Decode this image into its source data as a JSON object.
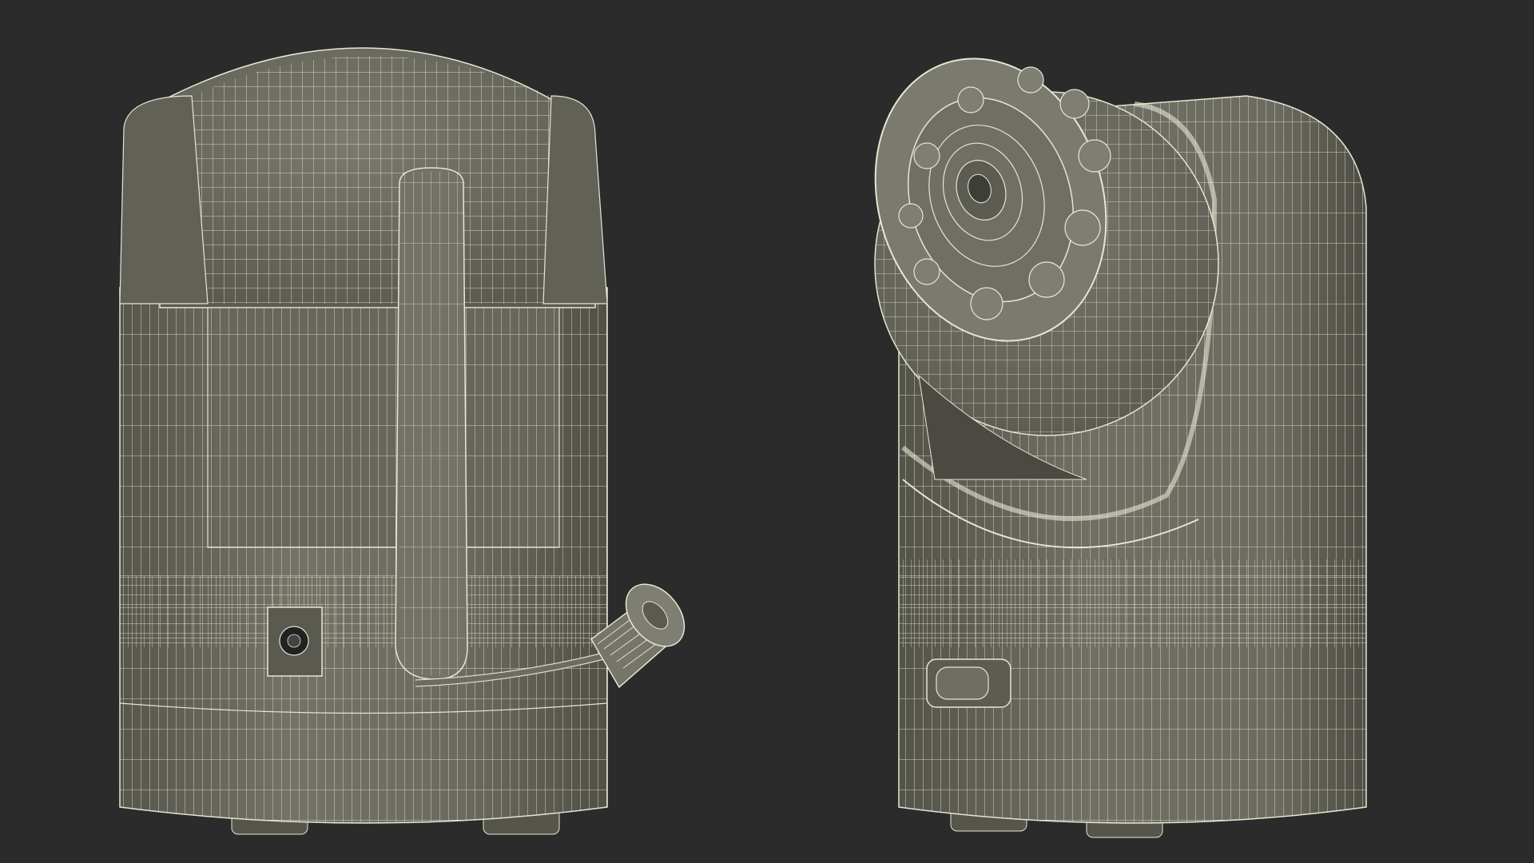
{
  "scene": {
    "background_color": "#2b2b2b",
    "body_fill": "#6d6d62",
    "body_fill_shade": "#5e5e54",
    "body_fill_light": "#7c7c70",
    "wire_color": "#e6e6d4",
    "objects": [
      {
        "name": "camera-rear-view",
        "view": "rear"
      },
      {
        "name": "camera-front-view",
        "view": "front-three-quarter"
      }
    ]
  }
}
